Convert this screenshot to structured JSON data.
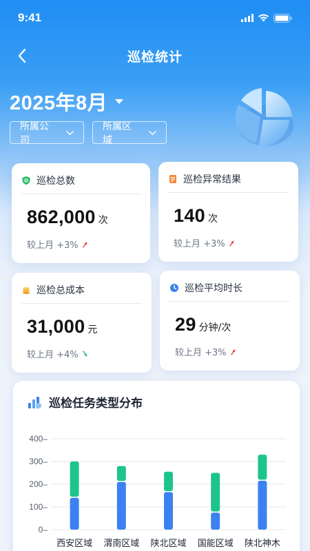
{
  "status": {
    "time": "9:41"
  },
  "nav": {
    "title": "巡检统计"
  },
  "date": {
    "label": "2025年8月"
  },
  "filters": [
    {
      "label": "所属公司"
    },
    {
      "label": "所属区域"
    }
  ],
  "cards": [
    {
      "title": "巡检总数",
      "value": "862,000",
      "unit": "次",
      "compare": "较上月 +3%",
      "trend": "up",
      "icon": "shield-check-icon",
      "icon_color": "#2fbf6a"
    },
    {
      "title": "巡检异常结果",
      "value": "140",
      "unit": "次",
      "compare": "较上月 +3%",
      "trend": "up",
      "icon": "report-icon",
      "icon_color": "#f08a3c"
    },
    {
      "title": "巡检总成本",
      "value": "31,000",
      "unit": "元",
      "compare": "较上月 +4%",
      "trend": "down",
      "icon": "coins-icon",
      "icon_color": "#f4b63a"
    },
    {
      "title": "巡检平均时长",
      "value": "29",
      "unit": "分钟/次",
      "compare": "较上月 +3%",
      "trend": "up",
      "icon": "clock-icon",
      "icon_color": "#3b82e8"
    }
  ],
  "colors": {
    "up": "#e23b2e",
    "down": "#1fb86a",
    "bar_bottom": "#3b82f0",
    "bar_top": "#1ec58b",
    "accent": "#1f8df3"
  },
  "chart_data": {
    "type": "bar",
    "stacked": true,
    "title": "巡检任务类型分布",
    "categories": [
      "西安区域",
      "渭南区域",
      "陕北区域",
      "国能区域",
      "陕北神木"
    ],
    "series": [
      {
        "values": [
          140,
          210,
          165,
          75,
          215
        ]
      },
      {
        "values": [
          160,
          70,
          90,
          175,
          115
        ]
      }
    ],
    "yticks": [
      "0",
      "100",
      "200",
      "300",
      "400"
    ],
    "ylim": [
      0,
      400
    ],
    "grid": true
  }
}
